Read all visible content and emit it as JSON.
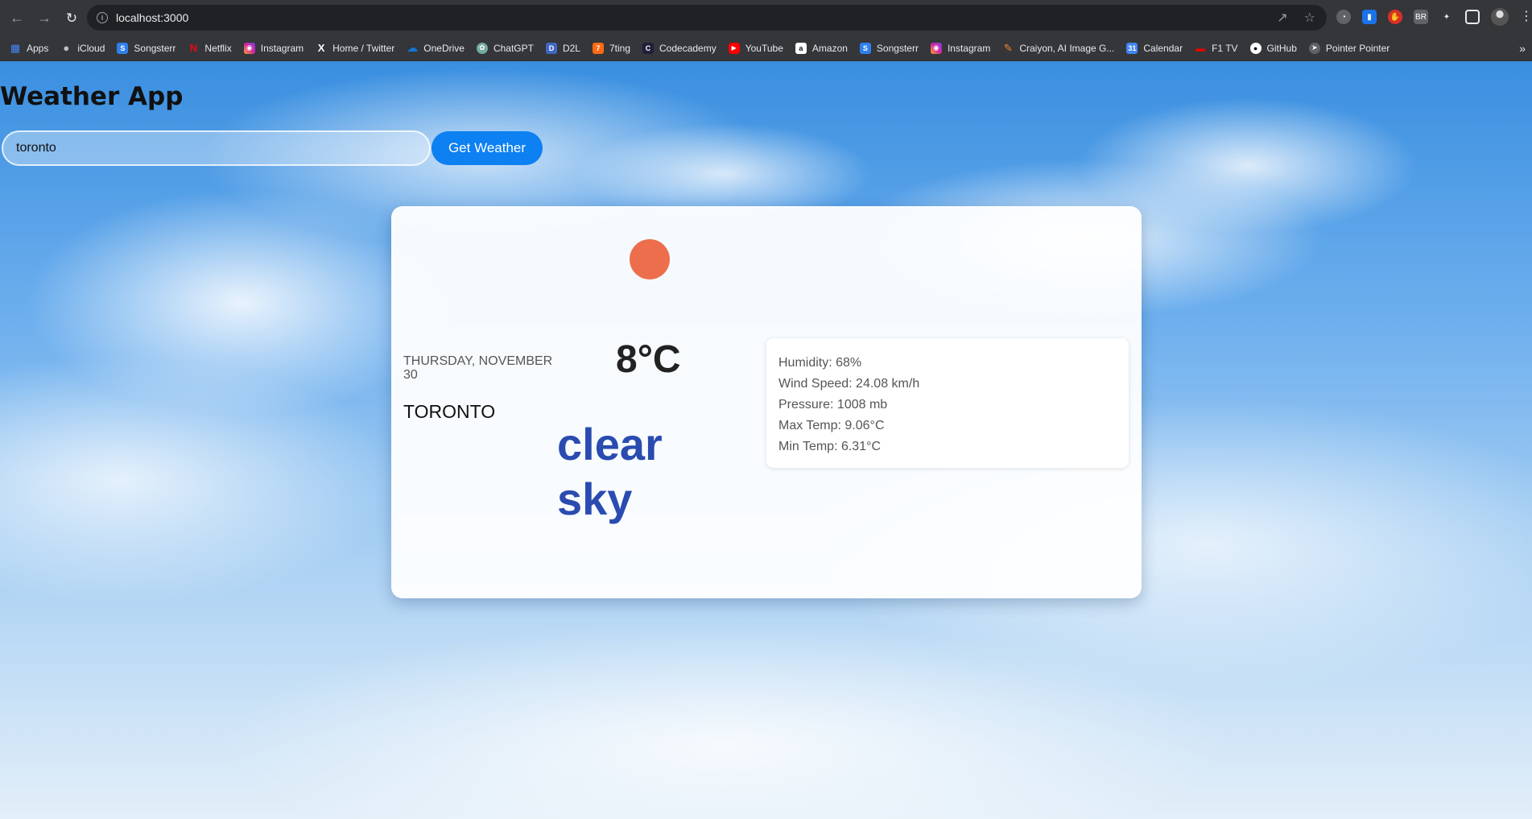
{
  "browser": {
    "url": "localhost:3000",
    "bookmarks": [
      {
        "label": "Apps",
        "icon": "apps-grid-icon",
        "color": "#4285f4"
      },
      {
        "label": "iCloud",
        "icon": "apple-icon",
        "color": "#9aa0a6"
      },
      {
        "label": "Songsterr",
        "icon": "songsterr-icon",
        "color": "#2f80ed"
      },
      {
        "label": "Netflix",
        "icon": "netflix-icon",
        "color": "#e50914"
      },
      {
        "label": "Instagram",
        "icon": "instagram-icon",
        "color": "#d6249f"
      },
      {
        "label": "Home / Twitter",
        "icon": "x-icon",
        "color": "#000000"
      },
      {
        "label": "OneDrive",
        "icon": "onedrive-icon",
        "color": "#0f78d4"
      },
      {
        "label": "ChatGPT",
        "icon": "chatgpt-icon",
        "color": "#74aa9c"
      },
      {
        "label": "D2L",
        "icon": "d2l-icon",
        "color": "#3f67c6"
      },
      {
        "label": "7ting",
        "icon": "7ting-icon",
        "color": "#ff6a13"
      },
      {
        "label": "Codecademy",
        "icon": "codecademy-icon",
        "color": "#1f1f3a"
      },
      {
        "label": "YouTube",
        "icon": "youtube-icon",
        "color": "#ff0000"
      },
      {
        "label": "Amazon",
        "icon": "amazon-icon",
        "color": "#ffffff"
      },
      {
        "label": "Songsterr",
        "icon": "songsterr-icon",
        "color": "#2f80ed"
      },
      {
        "label": "Instagram",
        "icon": "instagram-icon",
        "color": "#d6249f"
      },
      {
        "label": "Craiyon, AI Image G...",
        "icon": "craiyon-icon",
        "color": "#f08a24"
      },
      {
        "label": "Calendar",
        "icon": "calendar-icon",
        "color": "#4285f4"
      },
      {
        "label": "F1 TV",
        "icon": "f1-icon",
        "color": "#e10600"
      },
      {
        "label": "GitHub",
        "icon": "github-icon",
        "color": "#ffffff"
      },
      {
        "label": "Pointer Pointer",
        "icon": "pointer-icon",
        "color": "#cccccc"
      }
    ]
  },
  "app": {
    "title": "Weather App",
    "search": {
      "value": "toronto",
      "button_label": "Get Weather"
    },
    "weather": {
      "date": "Thursday, November 30",
      "city": "Toronto",
      "temperature": "8°C",
      "description": "clear sky",
      "icon": "sun-icon",
      "sun_color": "#ec6e4c"
    },
    "details": {
      "humidity": "Humidity: 68%",
      "wind_speed": "Wind Speed: 24.08 km/h",
      "pressure": "Pressure: 1008 mb",
      "max_temp": "Max Temp: 9.06°C",
      "min_temp": "Min Temp: 6.31°C"
    }
  }
}
